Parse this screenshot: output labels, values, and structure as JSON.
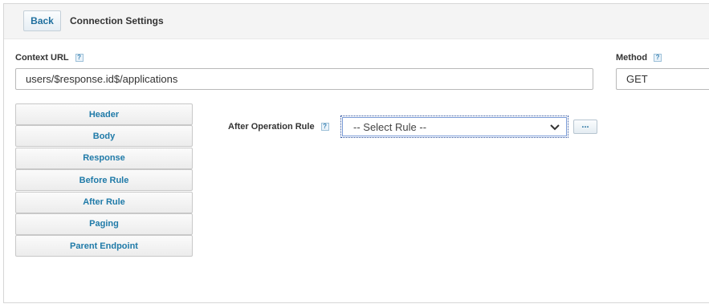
{
  "header": {
    "back_label": "Back",
    "title": "Connection Settings"
  },
  "context_url": {
    "label": "Context URL",
    "value": "users/$response.id$/applications"
  },
  "method": {
    "label": "Method",
    "value": "GET"
  },
  "help_glyph": "?",
  "nav": {
    "items": [
      {
        "label": "Header"
      },
      {
        "label": "Body"
      },
      {
        "label": "Response"
      },
      {
        "label": "Before Rule"
      },
      {
        "label": "After Rule"
      },
      {
        "label": "Paging"
      },
      {
        "label": "Parent Endpoint"
      }
    ]
  },
  "after_rule": {
    "label": "After Operation Rule",
    "selected": "-- Select Rule --",
    "browse_label": "..."
  },
  "icons": {
    "help": "help-icon",
    "dropdown": "chevron-down-icon"
  }
}
